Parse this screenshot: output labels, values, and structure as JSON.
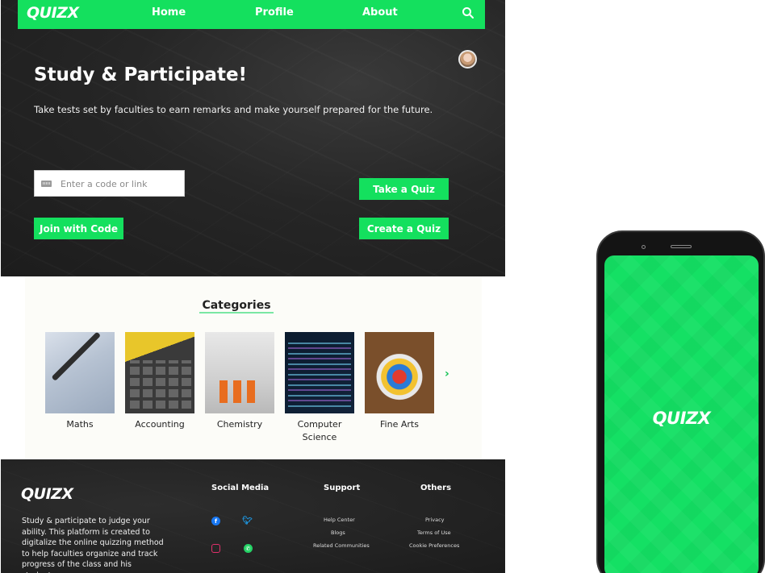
{
  "brand": {
    "logo_text": "QUIZX",
    "accent": "#14e05e"
  },
  "nav": {
    "links": [
      "Home",
      "Profile",
      "About"
    ],
    "search_icon": "search-icon"
  },
  "hero": {
    "title": "Study & Participate!",
    "subtitle": "Take tests set by faculties to earn remarks and make yourself prepared for the future.",
    "code_placeholder": "Enter a code or link",
    "take_quiz": "Take a Quiz",
    "join_code": "Join with Code",
    "create_quiz": "Create a Quiz"
  },
  "categories": {
    "title": "Categories",
    "items": [
      "Maths",
      "Accounting",
      "Chemistry",
      "Computer Science",
      "Fine Arts"
    ],
    "next_icon": "chevron-right-icon"
  },
  "footer": {
    "logo_text": "QUIZX",
    "description": "Study & participate to judge your ability. This platform is created to digitalize the online quizzing method to help faculties organize and track progress of the class and his students.",
    "social_heading": "Social Media",
    "support_heading": "Support",
    "others_heading": "Others",
    "support_links": [
      "Help Center",
      "Blogs",
      "Related Communities"
    ],
    "other_links": [
      "Privacy",
      "Terms of Use",
      "Cookie Preferences"
    ],
    "social_icons": [
      "facebook-icon",
      "twitter-icon",
      "instagram-icon",
      "whatsapp-icon"
    ]
  },
  "phone": {
    "logo_text": "QUIZX"
  }
}
